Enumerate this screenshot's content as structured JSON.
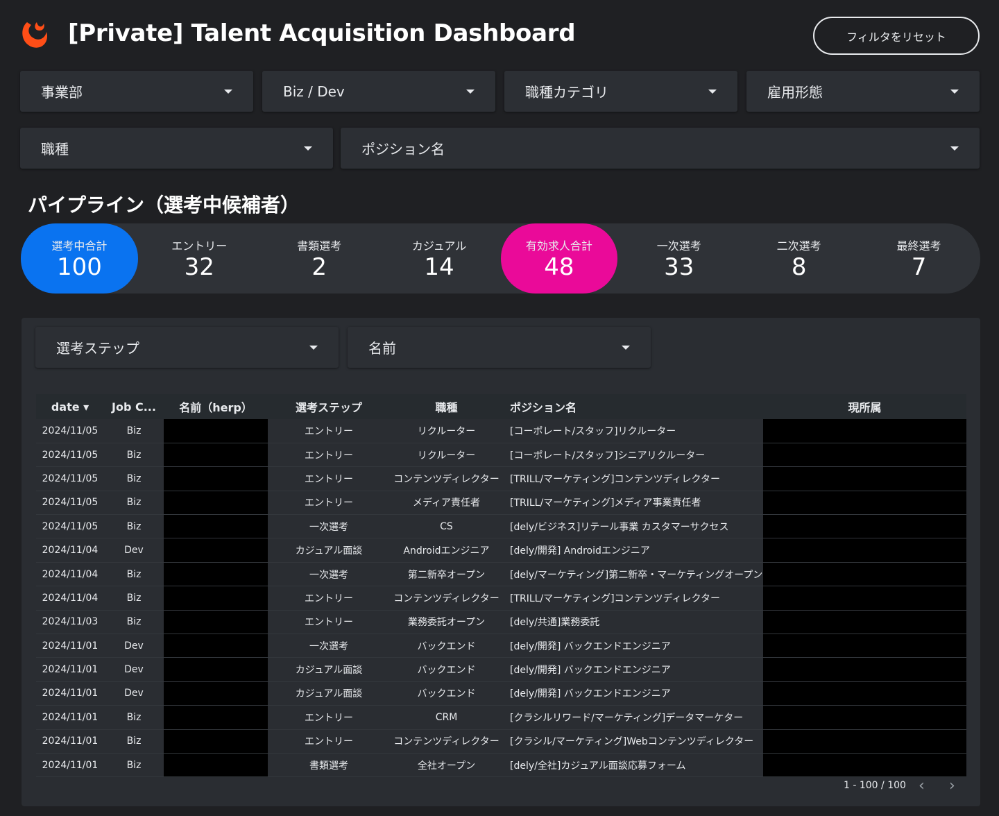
{
  "header": {
    "title": "[Private] Talent Acquisition Dashboard",
    "reset_label": "フィルタをリセット",
    "brand_color": "#ff4e17"
  },
  "filters": {
    "row1": [
      "事業部",
      "Biz / Dev",
      "職種カテゴリ",
      "雇用形態"
    ],
    "row2": [
      "職種",
      "ポジション名"
    ]
  },
  "pipeline": {
    "title": "パイプライン（選考中候補者）",
    "items": [
      {
        "label": "選考中合計",
        "value": "100",
        "color": "#0a73f0"
      },
      {
        "label": "エントリー",
        "value": "32"
      },
      {
        "label": "書類選考",
        "value": "2"
      },
      {
        "label": "カジュアル",
        "value": "14"
      },
      {
        "label": "有効求人合計",
        "value": "48",
        "color": "#ea0a99"
      },
      {
        "label": "一次選考",
        "value": "33"
      },
      {
        "label": "二次選考",
        "value": "8"
      },
      {
        "label": "最終選考",
        "value": "7"
      }
    ]
  },
  "table_filters": [
    "選考ステップ",
    "名前"
  ],
  "table": {
    "columns": [
      "date ▾",
      "Job C...",
      "名前（herp）",
      "選考ステップ",
      "職種",
      "ポジション名",
      "現所属"
    ],
    "rows": [
      [
        "2024/11/05",
        "Biz",
        "エントリー",
        "リクルーター",
        "[コーポレート/スタッフ]リクルーター"
      ],
      [
        "2024/11/05",
        "Biz",
        "エントリー",
        "リクルーター",
        "[コーポレート/スタッフ]シニアリクルーター"
      ],
      [
        "2024/11/05",
        "Biz",
        "エントリー",
        "コンテンツディレクター",
        "[TRILL/マーケティング]コンテンツディレクター"
      ],
      [
        "2024/11/05",
        "Biz",
        "エントリー",
        "メディア責任者",
        "[TRILL/マーケティング]メディア事業責任者"
      ],
      [
        "2024/11/05",
        "Biz",
        "一次選考",
        "CS",
        "[dely/ビジネス]リテール事業 カスタマーサクセス"
      ],
      [
        "2024/11/04",
        "Dev",
        "カジュアル面談",
        "Androidエンジニア",
        "[dely/開発] Androidエンジニア"
      ],
      [
        "2024/11/04",
        "Biz",
        "一次選考",
        "第二新卒オープン",
        "[dely/マーケティング]第二新卒・マーケティングオープン"
      ],
      [
        "2024/11/04",
        "Biz",
        "エントリー",
        "コンテンツディレクター",
        "[TRILL/マーケティング]コンテンツディレクター"
      ],
      [
        "2024/11/03",
        "Biz",
        "エントリー",
        "業務委託オープン",
        "[dely/共通]業務委託"
      ],
      [
        "2024/11/01",
        "Dev",
        "一次選考",
        "バックエンド",
        "[dely/開発] バックエンドエンジニア"
      ],
      [
        "2024/11/01",
        "Dev",
        "カジュアル面談",
        "バックエンド",
        "[dely/開発] バックエンドエンジニア"
      ],
      [
        "2024/11/01",
        "Dev",
        "カジュアル面談",
        "バックエンド",
        "[dely/開発] バックエンドエンジニア"
      ],
      [
        "2024/11/01",
        "Biz",
        "エントリー",
        "CRM",
        "[クラシルリワード/マーケティング]データマーケター"
      ],
      [
        "2024/11/01",
        "Biz",
        "エントリー",
        "コンテンツディレクター",
        "[クラシル/マーケティング]Webコンテンツディレクター"
      ],
      [
        "2024/11/01",
        "Biz",
        "書類選考",
        "全社オープン",
        "[dely/全社]カジュアル面談応募フォーム"
      ]
    ]
  },
  "pagination": {
    "label": "1 - 100 / 100"
  }
}
